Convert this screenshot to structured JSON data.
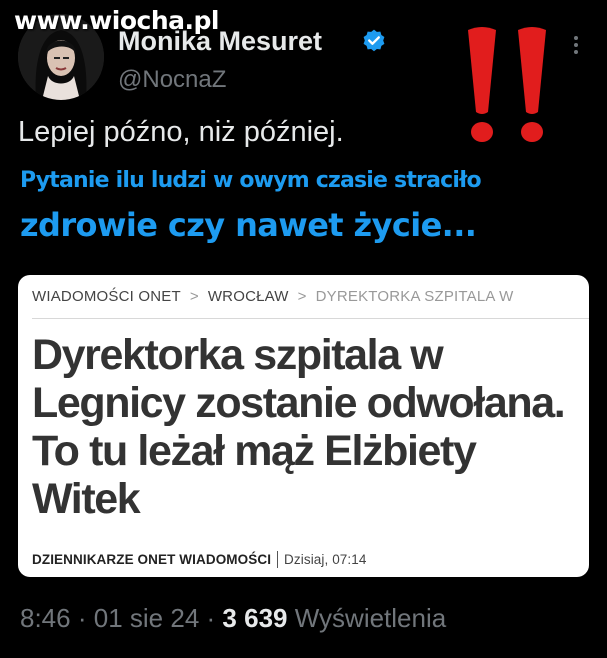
{
  "watermark": "www.wiocha.pl",
  "author": {
    "display_name": "Monika Mesuret",
    "handle": "@NocnaZ"
  },
  "tweet": {
    "text": "Lepiej późno, niż później."
  },
  "overlay": {
    "caption_line1": "Pytanie ilu ludzi w owym czasie straciło",
    "caption_line2": "zdrowie czy nawet życie...",
    "exclaim_color": "#e11d1d"
  },
  "card": {
    "breadcrumb": [
      "WIADOMOŚCI ONET",
      "WROCŁAW",
      "DYREKTORKA SZPITALA W"
    ],
    "breadcrumb_sep": ">",
    "headline": "Dyrektorka szpitala w Legnicy zostanie odwołana. To tu leżał mąż Elżbiety Witek",
    "byline_author": "DZIENNIKARZE ONET WIADOMOŚCI",
    "byline_date": "Dzisiaj, 07:14"
  },
  "meta": {
    "time": "8:46",
    "dot": "·",
    "date": "01 sie 24",
    "views_count": "3 639",
    "views_label": "Wyświetlenia"
  },
  "colors": {
    "background": "#000000",
    "accent": "#1d9bf0",
    "muted": "#71767b"
  }
}
